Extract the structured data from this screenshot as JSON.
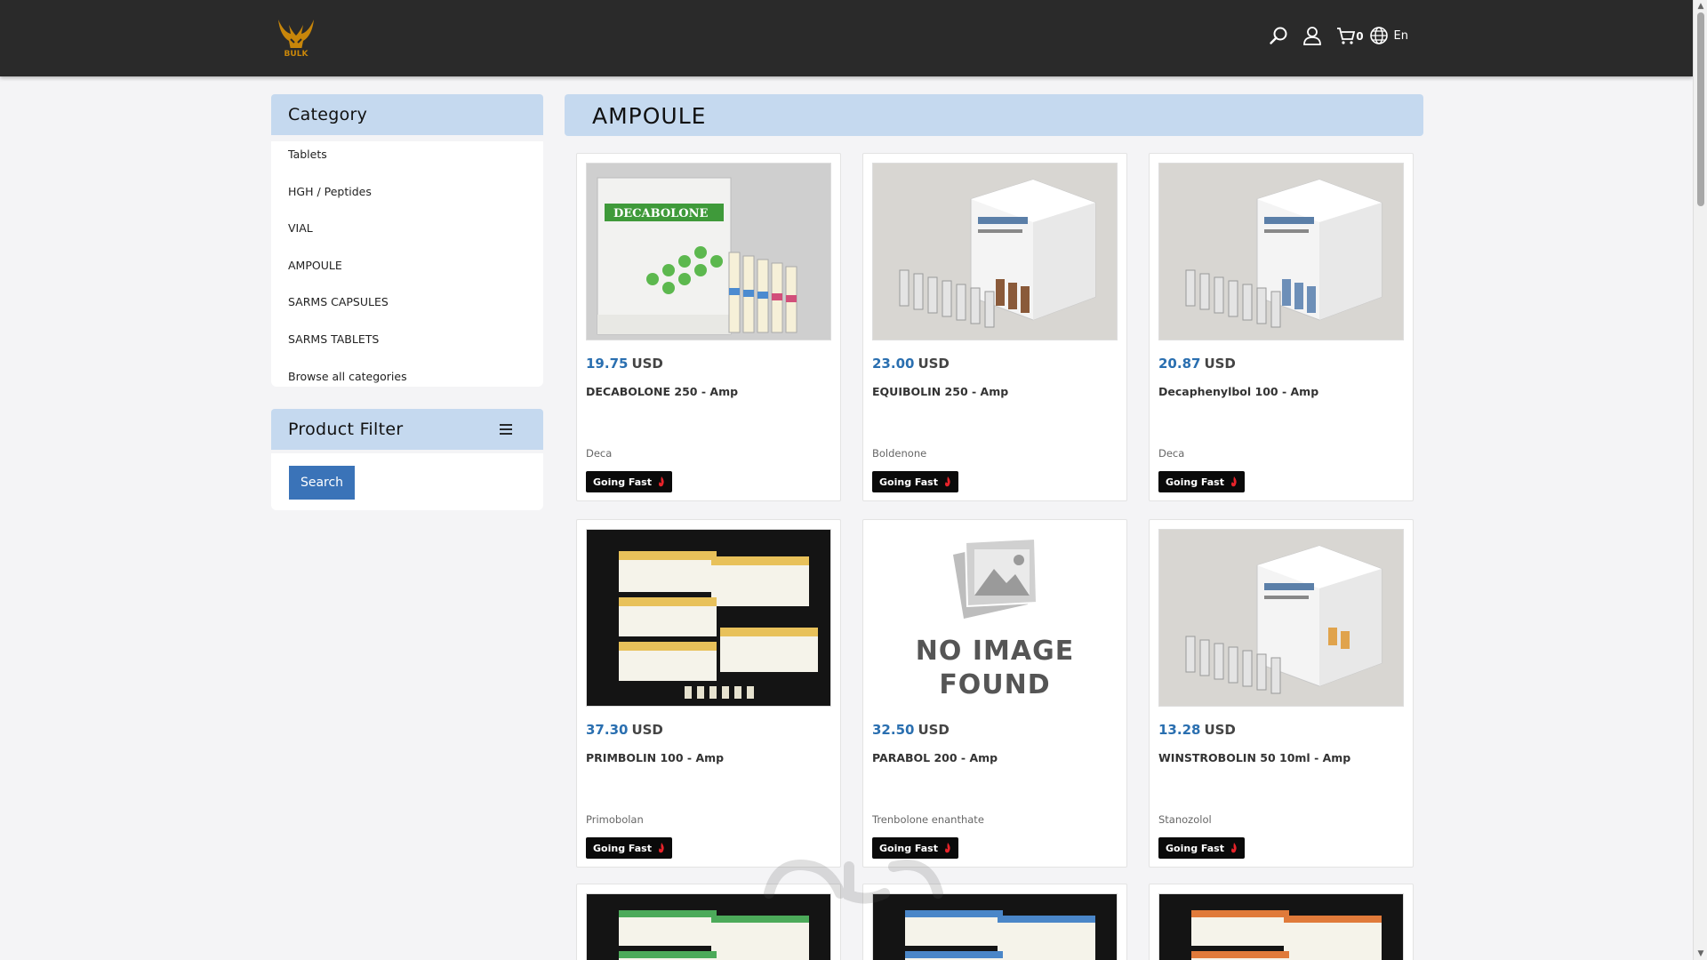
{
  "header": {
    "cart_count": "0",
    "language": "En",
    "logo_text": "BULK"
  },
  "sidebar": {
    "category_title": "Category",
    "categories": [
      "Tablets",
      "HGH / Peptides",
      "VIAL",
      "AMPOULE",
      "SARMS CAPSULES",
      "SARMS TABLETS",
      "Browse all categories"
    ],
    "filter_title": "Product Filter",
    "search_label": "Search"
  },
  "main": {
    "title": "AMPOULE",
    "products": [
      {
        "price": "19.75",
        "currency": "USD",
        "name": "DECABOLONE 250 - Amp",
        "category": "Deca",
        "badge": "Going Fast",
        "image": "decabolone-box"
      },
      {
        "price": "23.00",
        "currency": "USD",
        "name": "EQUIBOLIN 250 - Amp",
        "category": "Boldenone",
        "badge": "Going Fast",
        "image": "equibolin-box"
      },
      {
        "price": "20.87",
        "currency": "USD",
        "name": "Decaphenylbol 100 - Amp",
        "category": "Deca",
        "badge": "Going Fast",
        "image": "decaphenylbol-box"
      },
      {
        "price": "37.30",
        "currency": "USD",
        "name": "PRIMBOLIN 100 - Amp",
        "category": "Primobolan",
        "badge": "Going Fast",
        "image": "primbolin-boxes"
      },
      {
        "price": "32.50",
        "currency": "USD",
        "name": "PARABOL 200 - Amp",
        "category": "Trenbolone enanthate",
        "badge": "Going Fast",
        "image": "no-image",
        "placeholder_line1": "NO IMAGE",
        "placeholder_line2": "FOUND"
      },
      {
        "price": "13.28",
        "currency": "USD",
        "name": "WINSTROBOLIN 50 10ml - Amp",
        "category": "Stanozolol",
        "badge": "Going Fast",
        "image": "winstrobolin-box"
      }
    ]
  },
  "colors": {
    "header_bg": "#2a2a2a",
    "panel_head_bg": "#c5d9ef",
    "price_blue": "#2a6fb0",
    "button_blue": "#3a73b8",
    "badge_bg": "#0a0a0a"
  }
}
